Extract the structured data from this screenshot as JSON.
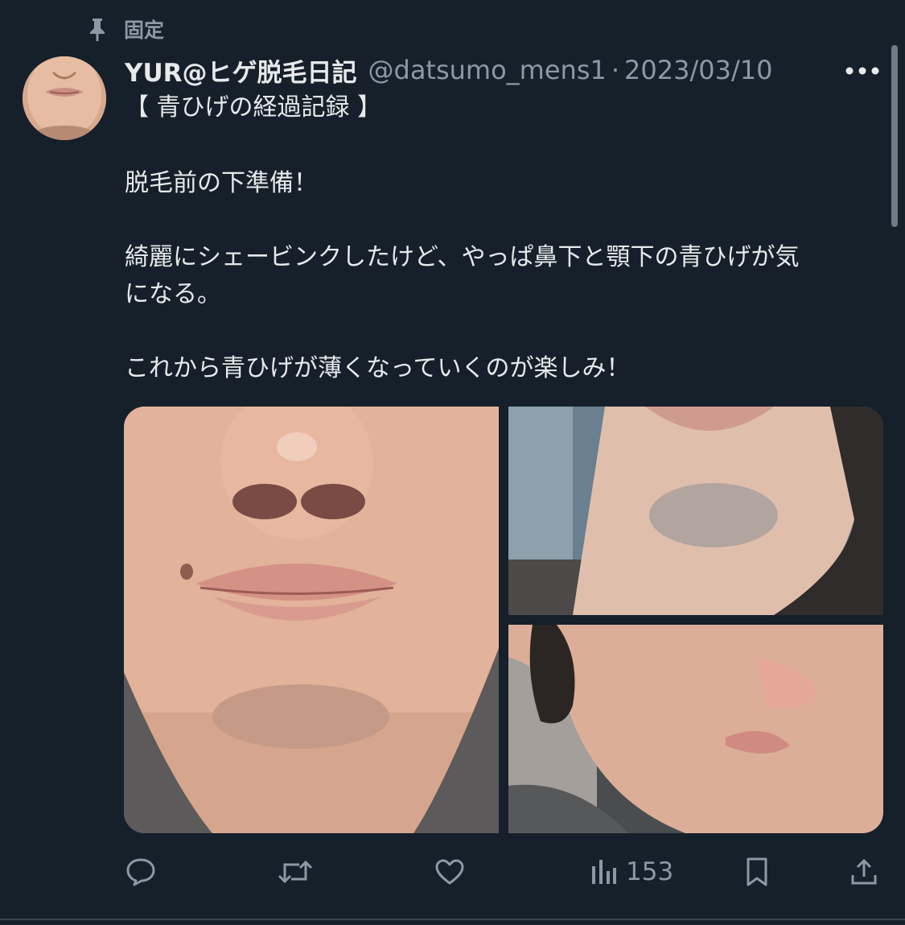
{
  "pinned": {
    "label": "固定",
    "icon": "pin-icon"
  },
  "author": {
    "display_name": "YUR@ヒゲ脱毛日記",
    "handle": "@datsumo_mens1",
    "separator": "·",
    "date": "2023/03/10"
  },
  "tweet": {
    "lines": [
      "【 青ひげの経過記録 】",
      "脱毛前の下準備！",
      "綺麗にシェービンクしたけど、やっぱ鼻下と顎下の青ひげが気",
      "になる。",
      "これから青ひげが薄くなっていくのが楽しみ！"
    ]
  },
  "actions": {
    "reply_icon": "reply-icon",
    "retweet_icon": "retweet-icon",
    "like_icon": "heart-icon",
    "views_icon": "views-chart-icon",
    "views_count": "153",
    "bookmark_icon": "bookmark-icon",
    "share_icon": "share-icon"
  },
  "colors": {
    "background": "#15202b",
    "primary_text": "#e7e9ea",
    "secondary_text": "#8b98a5"
  }
}
